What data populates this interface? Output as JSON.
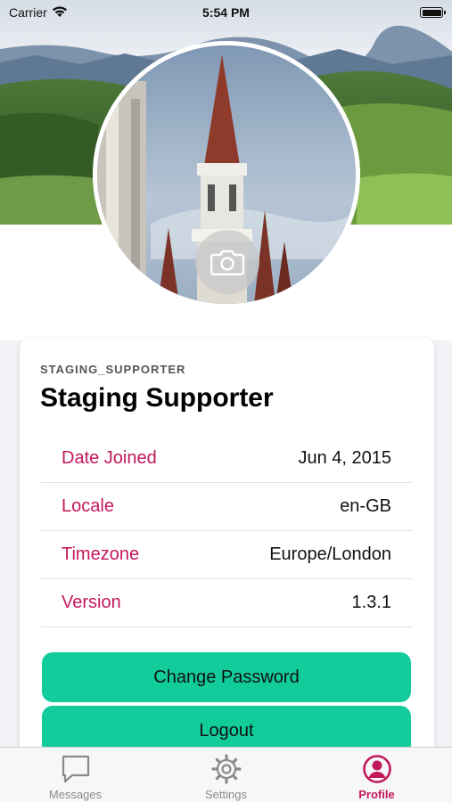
{
  "status_bar": {
    "carrier": "Carrier",
    "time": "5:54 PM",
    "wifi_icon": "wifi-icon",
    "battery_icon": "battery-icon"
  },
  "profile": {
    "username": "STAGING_SUPPORTER",
    "display_name": "Staging Supporter",
    "camera_icon": "camera-icon"
  },
  "details": [
    {
      "label": "Date Joined",
      "value": "Jun 4, 2015"
    },
    {
      "label": "Locale",
      "value": "en-GB"
    },
    {
      "label": "Timezone",
      "value": "Europe/London"
    },
    {
      "label": "Version",
      "value": "1.3.1"
    }
  ],
  "actions": {
    "change_password": "Change Password",
    "logout": "Logout"
  },
  "tab_bar": {
    "tabs": [
      {
        "label": "Messages",
        "icon": "messages-icon",
        "active": false
      },
      {
        "label": "Settings",
        "icon": "settings-gear-icon",
        "active": false
      },
      {
        "label": "Profile",
        "icon": "profile-icon",
        "active": true
      }
    ]
  },
  "colors": {
    "accent": "#c2185b",
    "button": "#12cc9b",
    "background": "#f2f2f7"
  }
}
